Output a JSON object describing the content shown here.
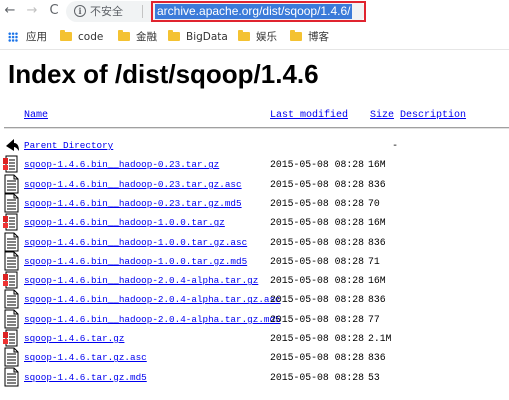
{
  "browser": {
    "back_icon": "←",
    "forward_icon": "→",
    "reload_icon": "C",
    "security_label": "不安全",
    "url": "archive.apache.org/dist/sqoop/1.4.6/"
  },
  "bookmarks": [
    {
      "label": "应用",
      "icon": "apps-icon"
    },
    {
      "label": "code",
      "icon": "folder-icon"
    },
    {
      "label": "金融",
      "icon": "folder-icon"
    },
    {
      "label": "BigData",
      "icon": "folder-icon"
    },
    {
      "label": "娱乐",
      "icon": "folder-icon"
    },
    {
      "label": "博客",
      "icon": "folder-icon"
    }
  ],
  "page": {
    "title": "Index of /dist/sqoop/1.4.6",
    "columns": {
      "name": "Name",
      "modified": "Last modified",
      "size": "Size",
      "description": "Description"
    },
    "rows": [
      {
        "icon": "back-icon",
        "name": "Parent Directory",
        "date": "",
        "size": "-"
      },
      {
        "icon": "archive-icon",
        "name": "sqoop-1.4.6.bin__hadoop-0.23.tar.gz",
        "date": "2015-05-08 08:28",
        "size": "16M"
      },
      {
        "icon": "text-icon",
        "name": "sqoop-1.4.6.bin__hadoop-0.23.tar.gz.asc",
        "date": "2015-05-08 08:28",
        "size": "836"
      },
      {
        "icon": "text-icon",
        "name": "sqoop-1.4.6.bin__hadoop-0.23.tar.gz.md5",
        "date": "2015-05-08 08:28",
        "size": "70"
      },
      {
        "icon": "archive-icon",
        "name": "sqoop-1.4.6.bin__hadoop-1.0.0.tar.gz",
        "date": "2015-05-08 08:28",
        "size": "16M"
      },
      {
        "icon": "text-icon",
        "name": "sqoop-1.4.6.bin__hadoop-1.0.0.tar.gz.asc",
        "date": "2015-05-08 08:28",
        "size": "836"
      },
      {
        "icon": "text-icon",
        "name": "sqoop-1.4.6.bin__hadoop-1.0.0.tar.gz.md5",
        "date": "2015-05-08 08:28",
        "size": "71"
      },
      {
        "icon": "archive-icon",
        "name": "sqoop-1.4.6.bin__hadoop-2.0.4-alpha.tar.gz",
        "date": "2015-05-08 08:28",
        "size": "16M"
      },
      {
        "icon": "text-icon",
        "name": "sqoop-1.4.6.bin__hadoop-2.0.4-alpha.tar.gz.asc",
        "date": "2015-05-08 08:28",
        "size": "836"
      },
      {
        "icon": "text-icon",
        "name": "sqoop-1.4.6.bin__hadoop-2.0.4-alpha.tar.gz.md5",
        "date": "2015-05-08 08:28",
        "size": "77"
      },
      {
        "icon": "archive-icon",
        "name": "sqoop-1.4.6.tar.gz",
        "date": "2015-05-08 08:28",
        "size": "2.1M"
      },
      {
        "icon": "text-icon",
        "name": "sqoop-1.4.6.tar.gz.asc",
        "date": "2015-05-08 08:28",
        "size": "836"
      },
      {
        "icon": "text-icon",
        "name": "sqoop-1.4.6.tar.gz.md5",
        "date": "2015-05-08 08:28",
        "size": "53"
      }
    ]
  },
  "colors": {
    "link": "#0000ee",
    "url_highlight": "#3b7bd9",
    "url_border": "#e0242f",
    "folder": "#f4c232"
  }
}
